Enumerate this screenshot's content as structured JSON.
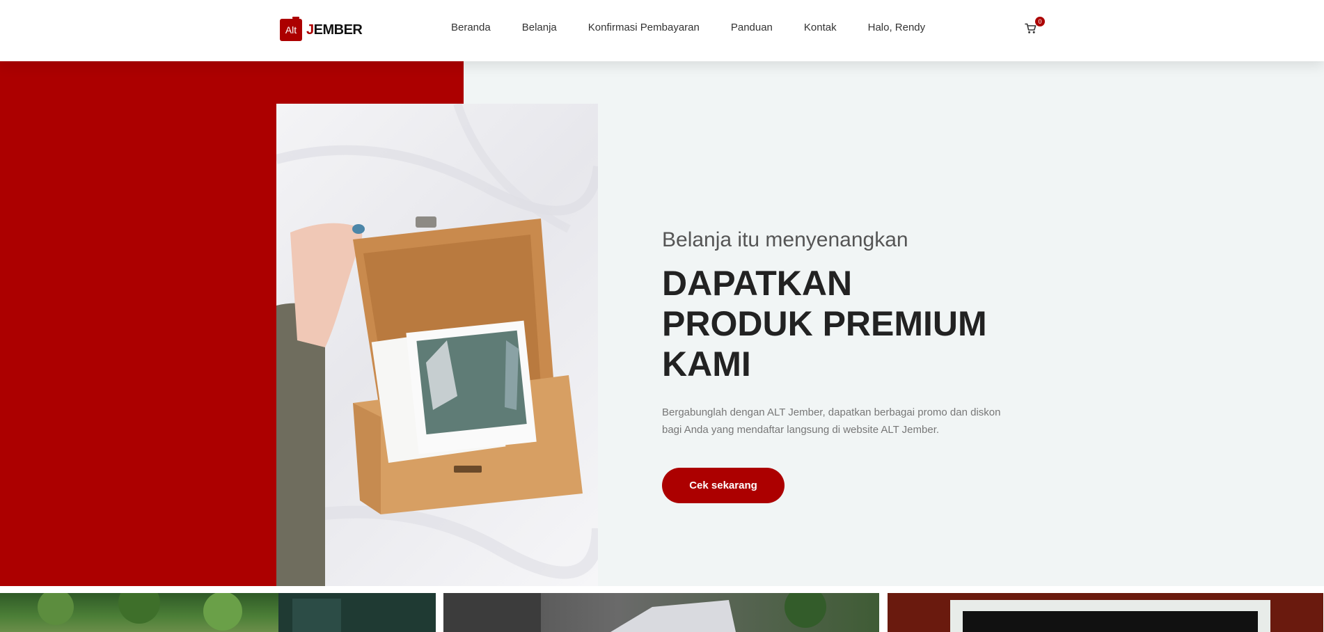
{
  "header": {
    "logo_box_text": "Alt",
    "logo_word_first": "J",
    "logo_word_rest": "EMBER",
    "nav": {
      "home": "Beranda",
      "shop": "Belanja",
      "payment": "Konfirmasi Pembayaran",
      "guide": "Panduan",
      "contact": "Kontak",
      "greeting": "Halo, Rendy"
    },
    "cart_icon": "cart-icon",
    "cart_count": "0"
  },
  "hero": {
    "subtitle": "Belanja itu menyenangkan",
    "title": "DAPATKAN PRODUK PREMIUM KAMI",
    "description": "Bergabunglah dengan ALT Jember, dapatkan berbagai promo dan diskon bagi Anda yang mendaftar langsung di website ALT Jember.",
    "cta": "Cek sekarang"
  },
  "colors": {
    "brand": "#ac0000",
    "hero_bg": "#f1f5f5",
    "heading": "#222222",
    "body_text": "#777777"
  }
}
